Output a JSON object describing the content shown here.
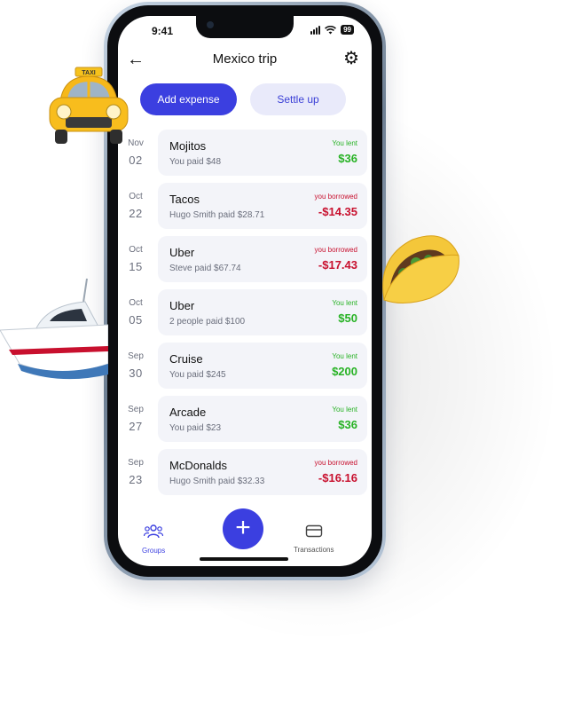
{
  "status": {
    "time": "9:41",
    "battery": "99"
  },
  "header": {
    "title": "Mexico trip"
  },
  "actions": {
    "add_expense": "Add expense",
    "settle_up": "Settle up"
  },
  "expenses": [
    {
      "month": "Nov",
      "day": "02",
      "name": "Mojitos",
      "paid": "You paid $48",
      "kind": "You lent",
      "amount": "$36",
      "type": "lent"
    },
    {
      "month": "Oct",
      "day": "22",
      "name": "Tacos",
      "paid": "Hugo Smith paid $28.71",
      "kind": "you borrowed",
      "amount": "-$14.35",
      "type": "borrowed"
    },
    {
      "month": "Oct",
      "day": "15",
      "name": "Uber",
      "paid": "Steve paid $67.74",
      "kind": "you borrowed",
      "amount": "-$17.43",
      "type": "borrowed"
    },
    {
      "month": "Oct",
      "day": "05",
      "name": "Uber",
      "paid": "2 people paid $100",
      "kind": "You lent",
      "amount": "$50",
      "type": "lent"
    },
    {
      "month": "Sep",
      "day": "30",
      "name": "Cruise",
      "paid": "You paid $245",
      "kind": "You lent",
      "amount": "$200",
      "type": "lent"
    },
    {
      "month": "Sep",
      "day": "27",
      "name": "Arcade",
      "paid": "You paid $23",
      "kind": "You lent",
      "amount": "$36",
      "type": "lent"
    },
    {
      "month": "Sep",
      "day": "23",
      "name": "McDonalds",
      "paid": "Hugo Smith paid $32.33",
      "kind": "you borrowed",
      "amount": "-$16.16",
      "type": "borrowed"
    }
  ],
  "tabbar": {
    "groups": "Groups",
    "transactions": "Transactions"
  },
  "icons": {
    "back": "arrow-left-icon",
    "settings": "gear-icon",
    "groups": "people-icon",
    "transactions": "card-icon",
    "add": "plus-icon"
  },
  "decor": {
    "taxi_sign": "TAXI"
  },
  "colors": {
    "accent": "#3b3fe0",
    "lent": "#27b224",
    "borrowed": "#c8102e"
  }
}
